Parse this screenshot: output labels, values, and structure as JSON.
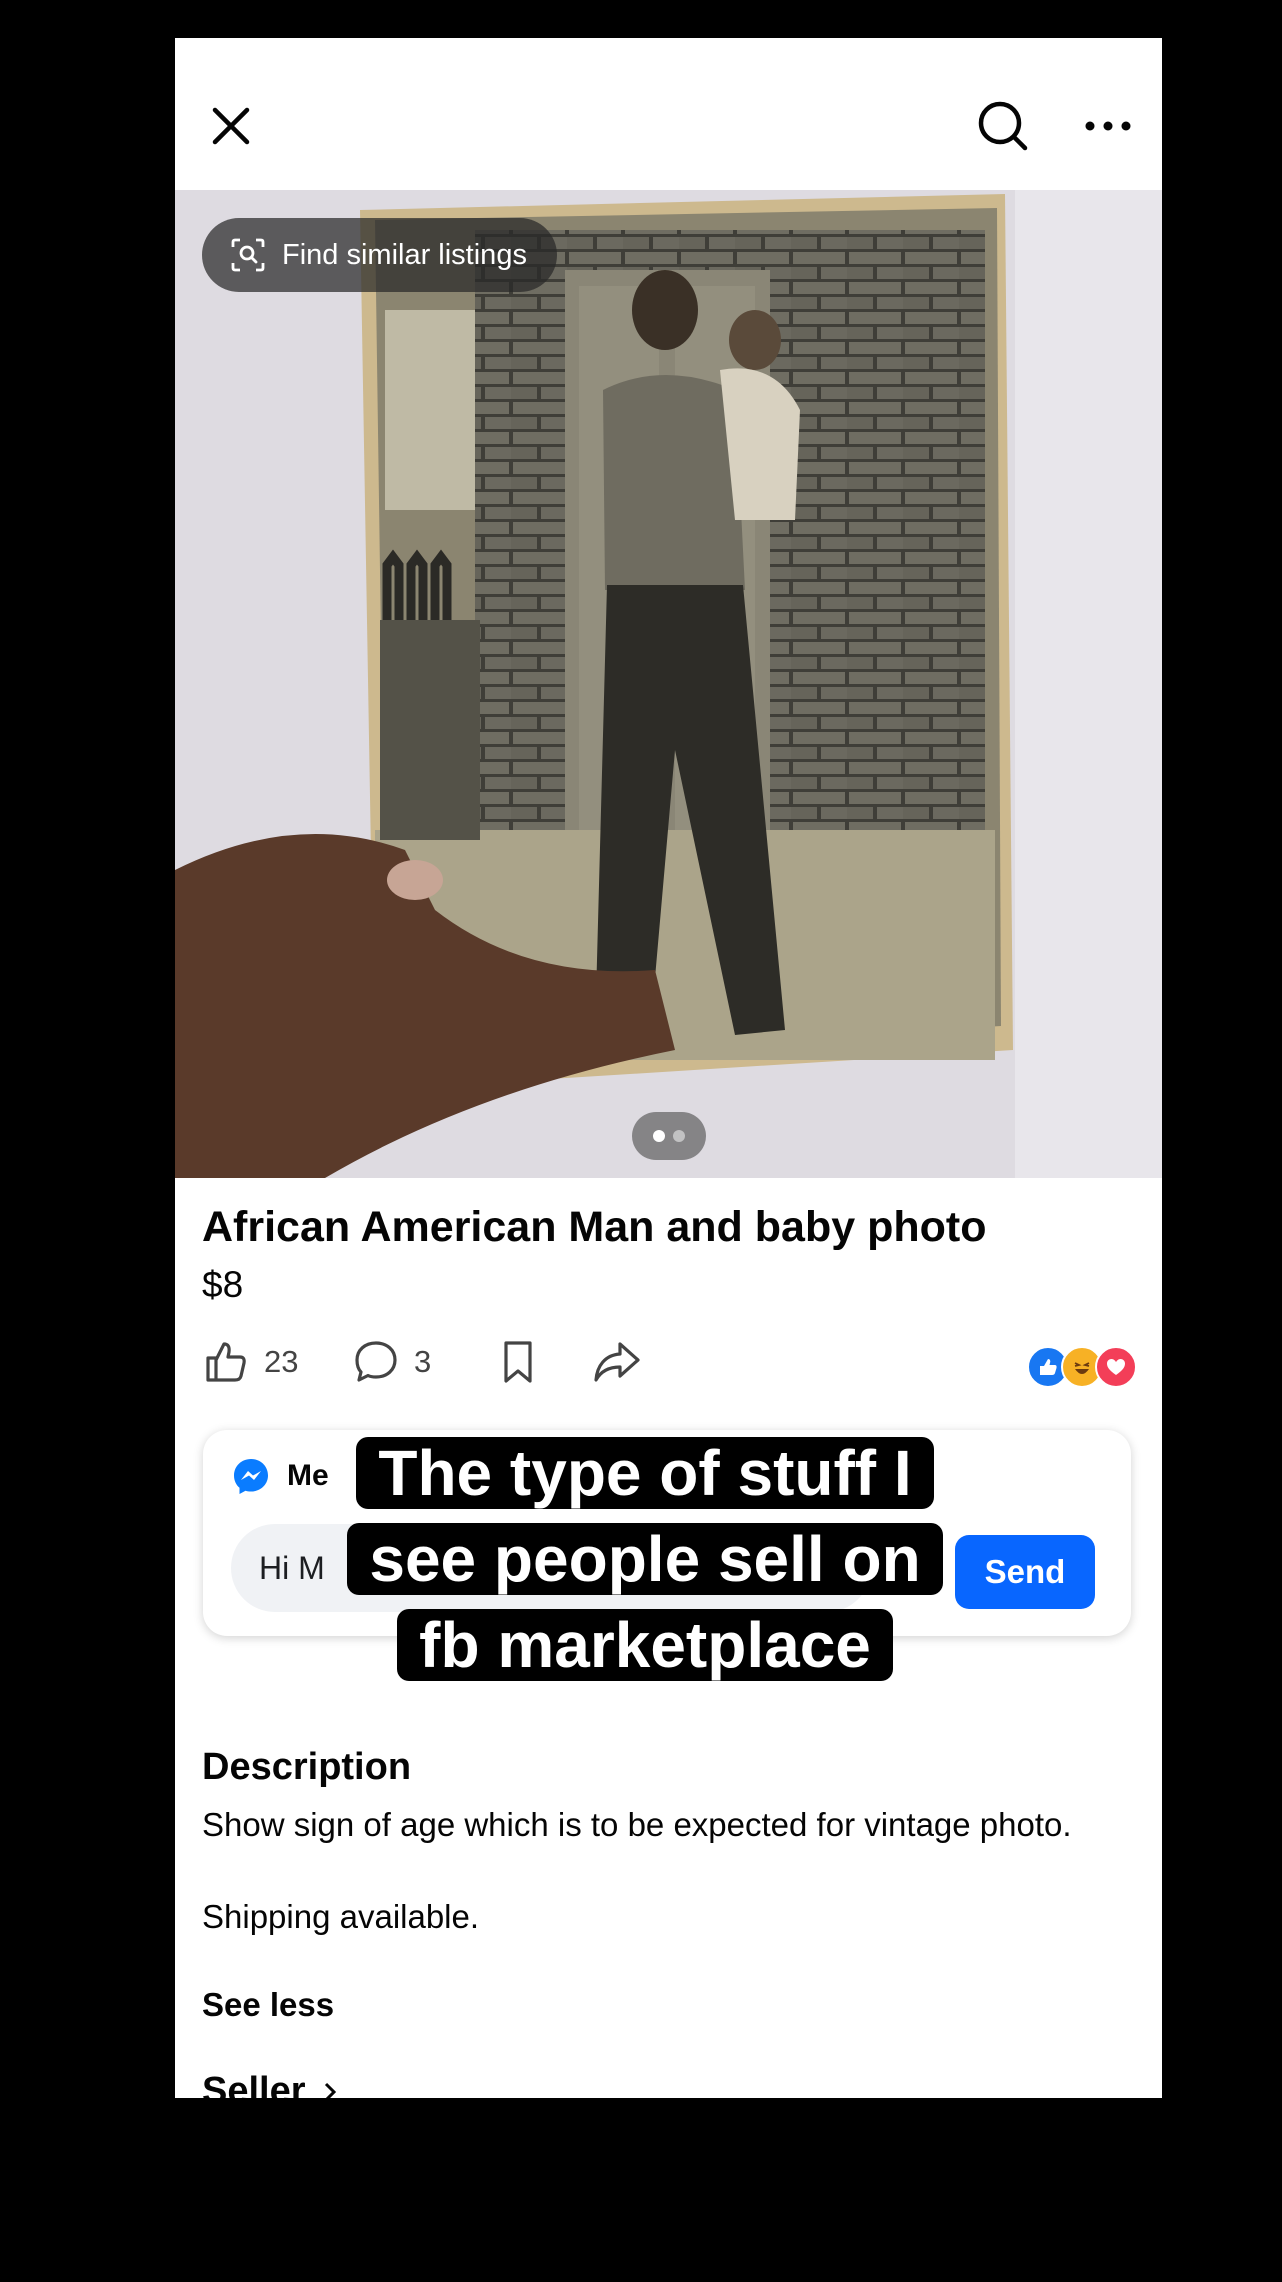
{
  "top_bar": {
    "close_icon": "close-icon",
    "search_icon": "search-icon",
    "more_icon": "more-options-icon"
  },
  "photo": {
    "find_similar_label": "Find similar listings",
    "image_count": 2,
    "current_image": 1
  },
  "listing": {
    "title": "African American Man and baby photo",
    "price": "$8",
    "likes": "23",
    "comments": "3"
  },
  "message": {
    "app_label_partial": "Me",
    "input_value_partial": "Hi M",
    "send_label": "Send"
  },
  "caption": {
    "line1": "The type of stuff I",
    "line2": "see people sell on",
    "line3": "fb marketplace"
  },
  "description": {
    "heading": "Description",
    "body": "Show sign of age which is to be expected for vintage photo.",
    "shipping": "Shipping available.",
    "toggle_label": "See less"
  },
  "seller": {
    "heading": "Seller"
  },
  "colors": {
    "accent": "#0866ff",
    "like_reaction": "#1877f2",
    "love_reaction": "#f33e58",
    "haha_reaction": "#f7b125"
  }
}
